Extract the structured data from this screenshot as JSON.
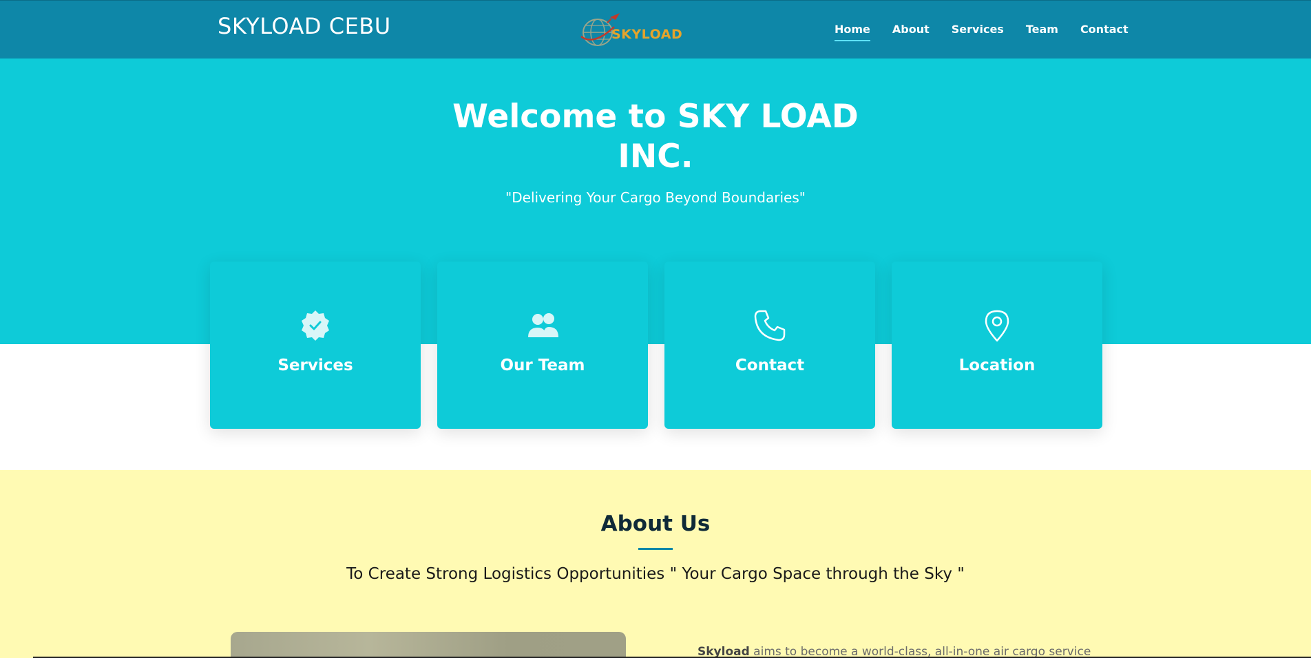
{
  "header": {
    "brand": "SKYLOAD CEBU",
    "logo_text": "SKYLOAD",
    "nav": [
      {
        "label": "Home",
        "active": true
      },
      {
        "label": "About",
        "active": false
      },
      {
        "label": "Services",
        "active": false
      },
      {
        "label": "Team",
        "active": false
      },
      {
        "label": "Contact",
        "active": false
      }
    ]
  },
  "hero": {
    "title_line1": "Welcome to SKY LOAD",
    "title_line2": "INC.",
    "subtitle": "\"Delivering Your Cargo Beyond Boundaries\""
  },
  "cards": [
    {
      "label": "Services",
      "icon": "verified-badge-icon"
    },
    {
      "label": "Our Team",
      "icon": "people-icon"
    },
    {
      "label": "Contact",
      "icon": "phone-icon"
    },
    {
      "label": "Location",
      "icon": "map-pin-icon"
    }
  ],
  "about": {
    "title": "About Us",
    "tagline": "To Create Strong Logistics Opportunities \" Your Cargo Space through the Sky \"",
    "body_bold": "Skyload",
    "body_text": " aims to become a world-class, all-in-one air cargo service"
  },
  "colors": {
    "header": "#0e87a8",
    "hero": "#0ecbd8",
    "about_bg": "#fffab3",
    "accent": "#0e87a8",
    "logo_gold": "#e6a42b"
  }
}
